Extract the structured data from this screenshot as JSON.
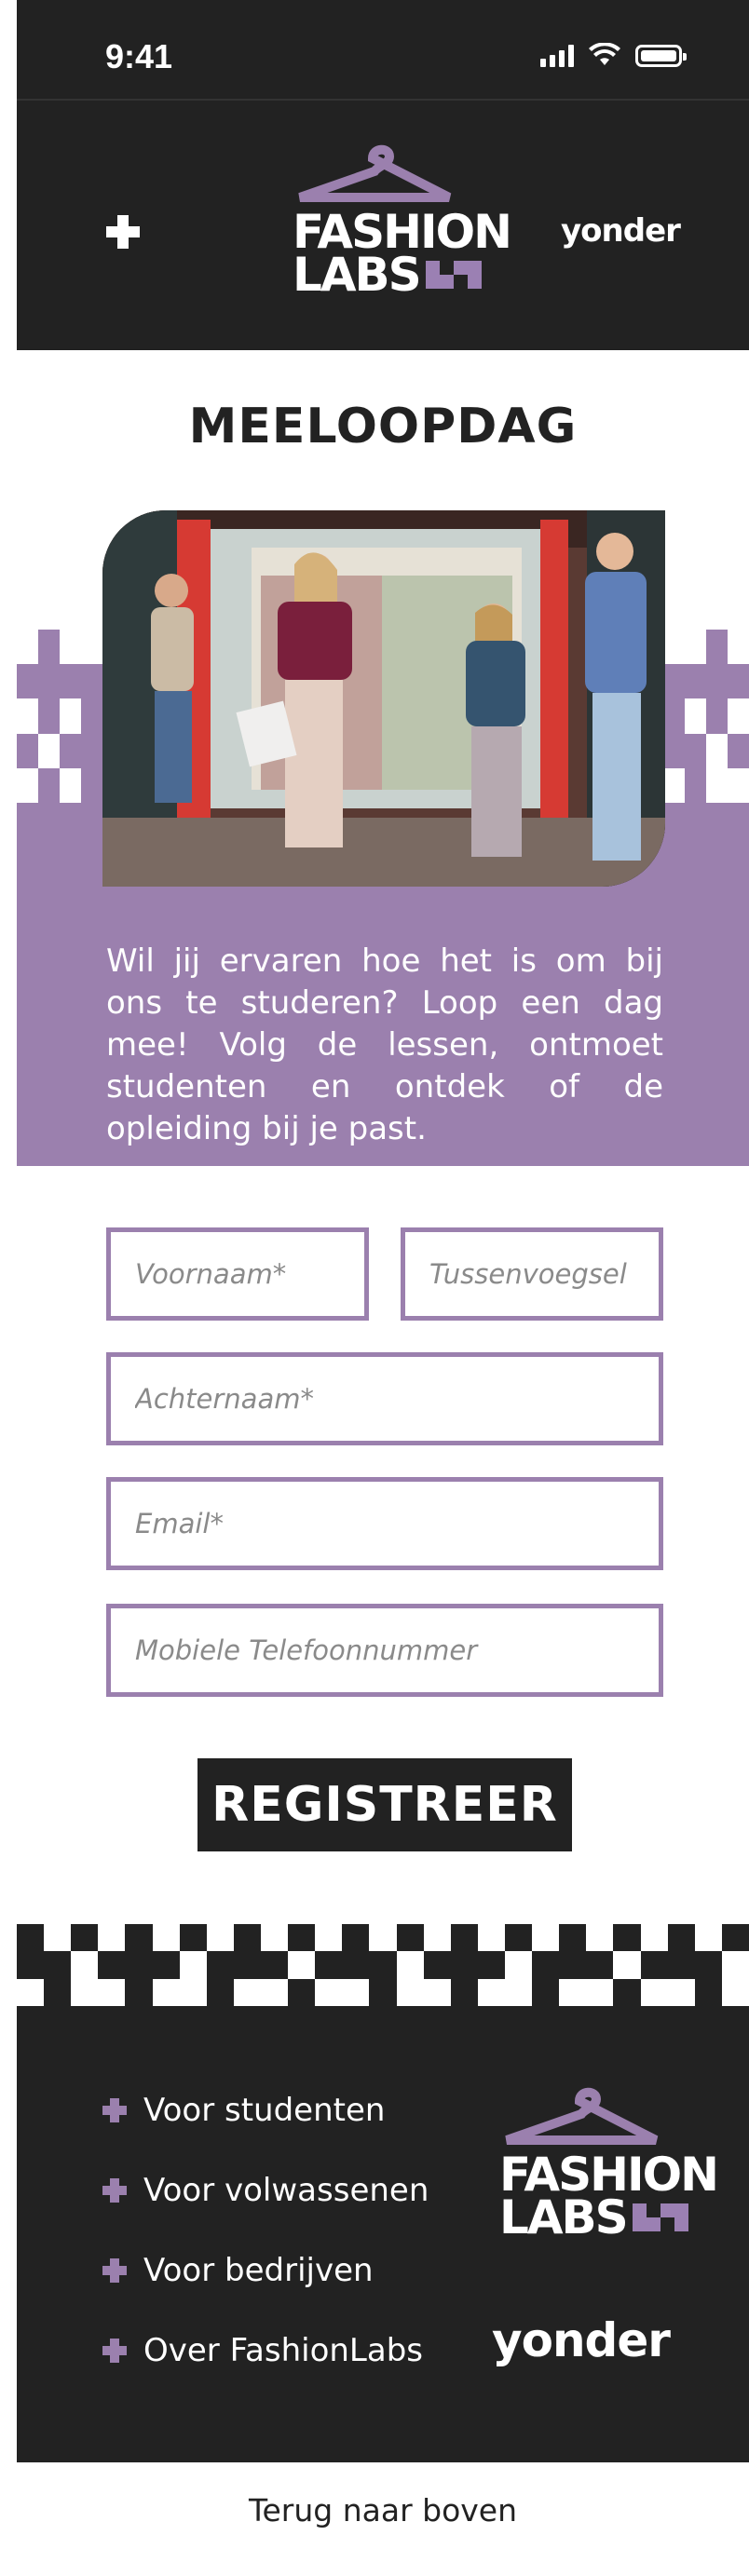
{
  "status_bar": {
    "time": "9:41"
  },
  "header": {
    "logo": {
      "line1": "FASHION",
      "line2": "LABS"
    },
    "partner": {
      "text": "yonder"
    }
  },
  "page": {
    "title": "MEELOOPDAG"
  },
  "intro": {
    "text": "Wil jij ervaren hoe het is om bij ons te studeren? Loop een dag mee! Volg de lessen, ontmoet studenten en ontdek of de opleiding bij je past."
  },
  "form": {
    "first_name_placeholder": "Voornaam*",
    "infix_placeholder": "Tussenvoegsel",
    "last_name_placeholder": "Achternaam*",
    "email_placeholder": "Email*",
    "phone_placeholder": "Mobiele Telefoonnummer",
    "submit_label": "REGISTREER"
  },
  "footer": {
    "nav": [
      {
        "label": "Voor studenten"
      },
      {
        "label": "Voor volwassenen"
      },
      {
        "label": "Voor bedrijven"
      },
      {
        "label": "Over FashionLabs"
      }
    ],
    "logo": {
      "line1": "FASHION",
      "line2": "LABS"
    },
    "partner": {
      "text": "yonder"
    }
  },
  "back_to_top": "Terug naar boven",
  "colors": {
    "accent": "#9b80ae",
    "dark": "#222222",
    "background": "#ffffff",
    "yonder_dot": "#e4533c"
  },
  "icons": [
    "plus-menu-icon",
    "hanger-icon",
    "signal-icon",
    "wifi-icon",
    "battery-icon",
    "plus-bullet-icon"
  ]
}
